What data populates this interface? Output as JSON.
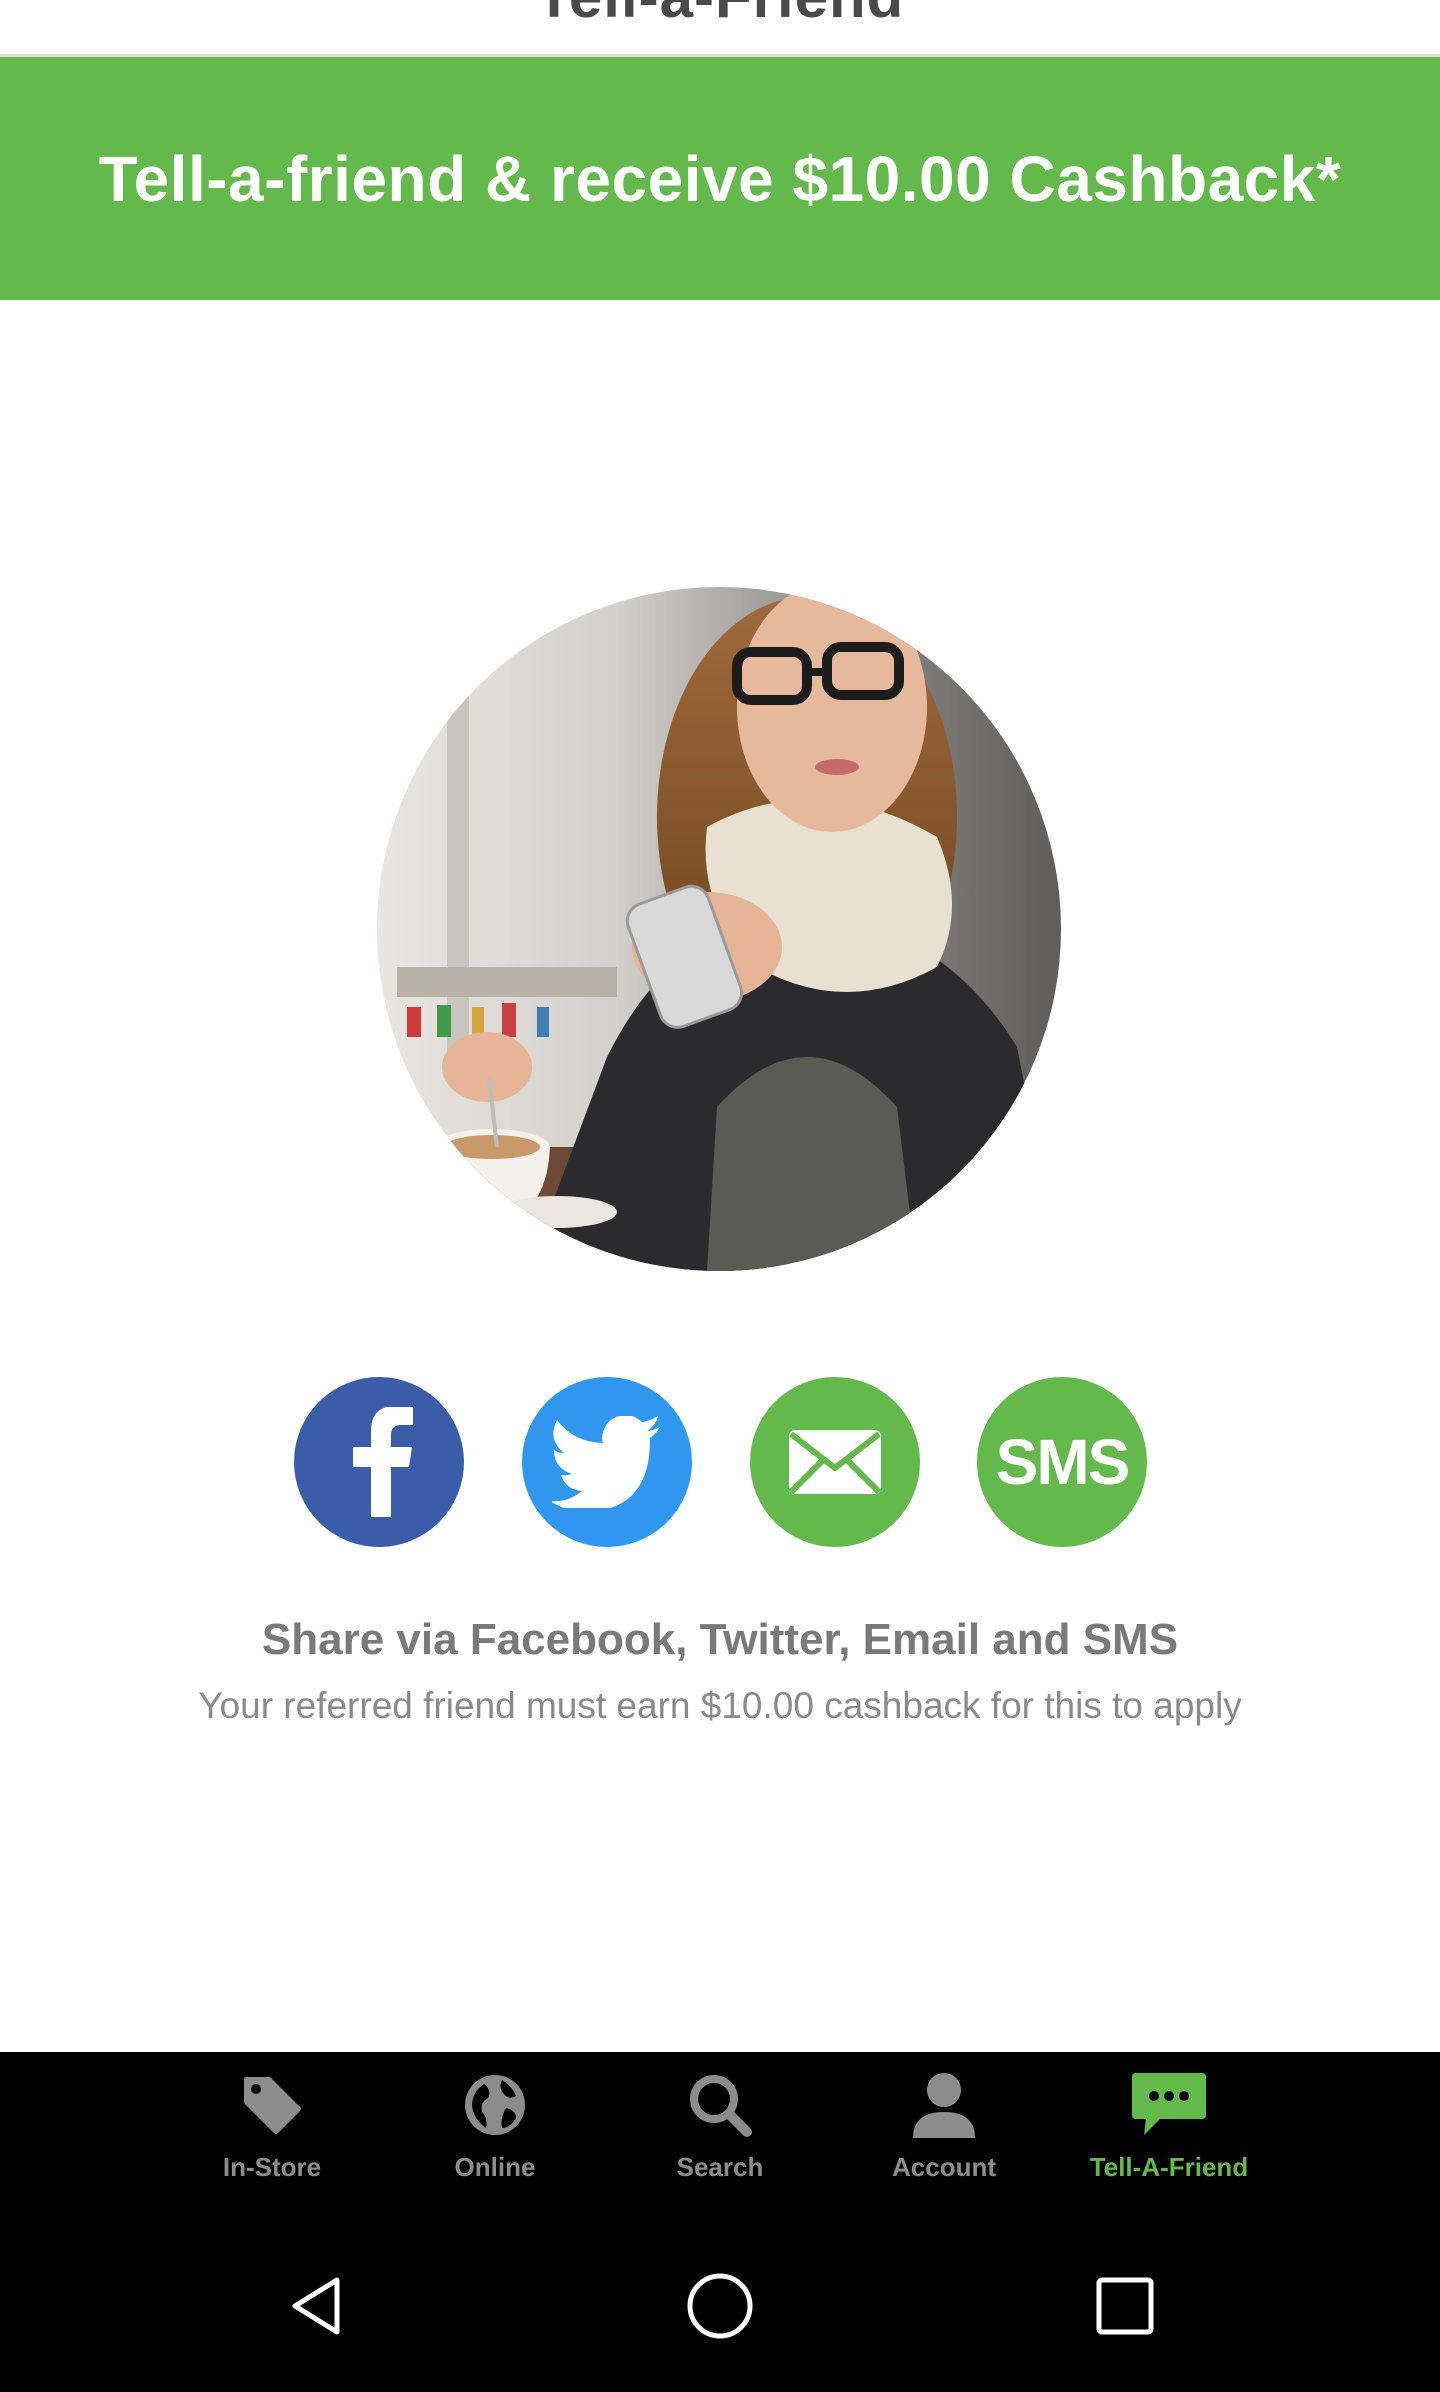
{
  "header": {
    "title": "Tell-a-Friend"
  },
  "banner": {
    "text": "Tell-a-friend & receive $10.00 Cashback*"
  },
  "share": {
    "buttons": [
      {
        "name": "facebook",
        "label": ""
      },
      {
        "name": "twitter",
        "label": ""
      },
      {
        "name": "email",
        "label": ""
      },
      {
        "name": "sms",
        "label": "SMS"
      }
    ],
    "title": "Share via Facebook, Twitter, Email and SMS",
    "note": "Your referred friend must earn $10.00 cashback for this to apply"
  },
  "tabs": [
    {
      "label": "In-Store",
      "icon": "tag-icon",
      "active": false
    },
    {
      "label": "Online",
      "icon": "globe-icon",
      "active": false
    },
    {
      "label": "Search",
      "icon": "search-icon",
      "active": false
    },
    {
      "label": "Account",
      "icon": "person-icon",
      "active": false
    },
    {
      "label": "Tell-A-Friend",
      "icon": "chat-bubble-icon",
      "active": true
    }
  ],
  "colors": {
    "brand_green": "#63b94b",
    "facebook_blue": "#3b5ca8",
    "twitter_blue": "#2f98ee",
    "tab_inactive": "#8c8c8c"
  }
}
